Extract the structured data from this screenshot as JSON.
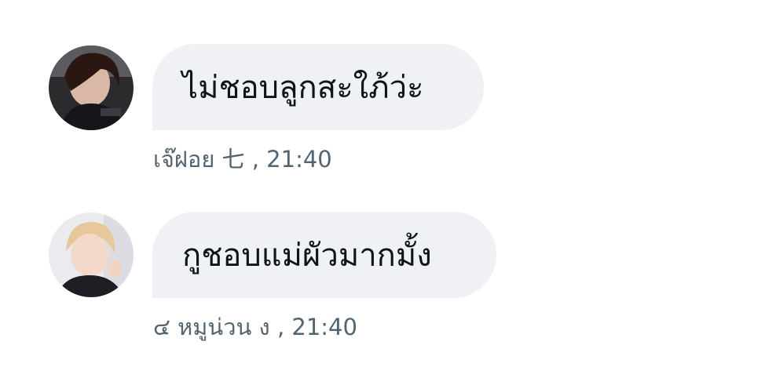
{
  "messages": [
    {
      "text": "ไม่ชอบลูกสะใภ้ว่ะ",
      "sender": "เจ๊ฝอย 七",
      "time": ", 21:40"
    },
    {
      "text": "กูชอบแม่ผัวมากมั้ง",
      "sender": "๔ หมูน่วน ง",
      "time": ", 21:40"
    }
  ],
  "colors": {
    "bubble": "#eff1f4",
    "text": "#0f1419",
    "meta": "#536471"
  }
}
